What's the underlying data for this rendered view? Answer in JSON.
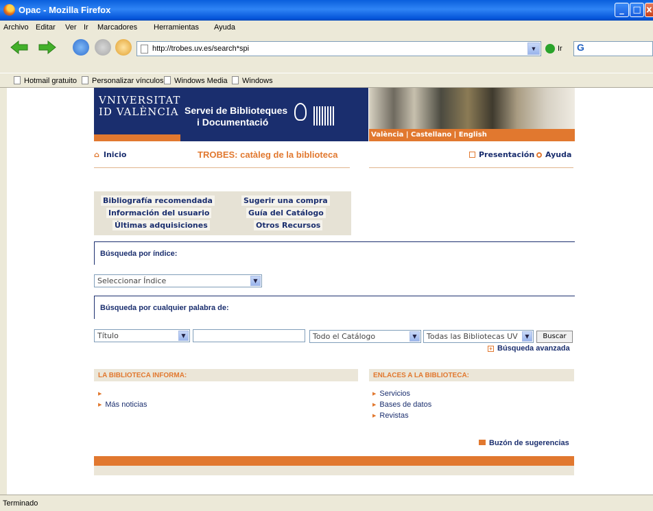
{
  "window": {
    "title": "Opac - Mozilla Firefox"
  },
  "menu": [
    "Archivo",
    "Editar",
    "Ver",
    "Ir",
    "Marcadores",
    "Herramientas",
    "Ayuda"
  ],
  "nav": {
    "url": "http://trobes.uv.es/search*spi",
    "go_label": "Ir",
    "search_engine": "G"
  },
  "bookmarks": [
    "Hotmail gratuito",
    "Personalizar vínculos",
    "Windows Media",
    "Windows"
  ],
  "header": {
    "uv_line1": "VNIVERSITAT",
    "uv_line2": "ID VALÈNCIA",
    "sbd_line1": "Servei de Biblioteques",
    "sbd_line2": "i Documentació",
    "languages": "València | Castellano | English"
  },
  "topnav": {
    "inicio": "Inicio",
    "trobes": "TROBES: catàleg de la biblioteca",
    "presentacion": "Presentación",
    "ayuda": "Ayuda"
  },
  "links": {
    "bibliografia": "Bibliografía recomendada",
    "sugerir": "Sugerir una compra",
    "info_usuario": "Información del usuario",
    "guia": "Guía del Catálogo",
    "ultimas": "Últimas adquisiciones",
    "otros": "Otros Recursos"
  },
  "search_index": {
    "label": "Búsqueda por índice:",
    "select_value": "Seleccionar Índice"
  },
  "search_word": {
    "label": "Búsqueda por cualquier palabra de:",
    "field_select": "Título",
    "query": "",
    "catalog_select": "Todo el Catálogo",
    "library_select": "Todas las Bibliotecas UV",
    "buscar": "Buscar",
    "advanced": "Búsqueda avanzada"
  },
  "news": {
    "heading": "LA BIBLIOTECA INFORMA:",
    "more": "Más noticias"
  },
  "enlaces": {
    "heading": "ENLACES A LA BIBLIOTECA:",
    "items": [
      "Servicios",
      "Bases de datos",
      "Revistas"
    ]
  },
  "buzon": "Buzón de sugerencias",
  "status": "Terminado",
  "colors": {
    "accent": "#e1782f",
    "navy": "#1a2e6e",
    "xp_blue": "#0a5fdc"
  }
}
